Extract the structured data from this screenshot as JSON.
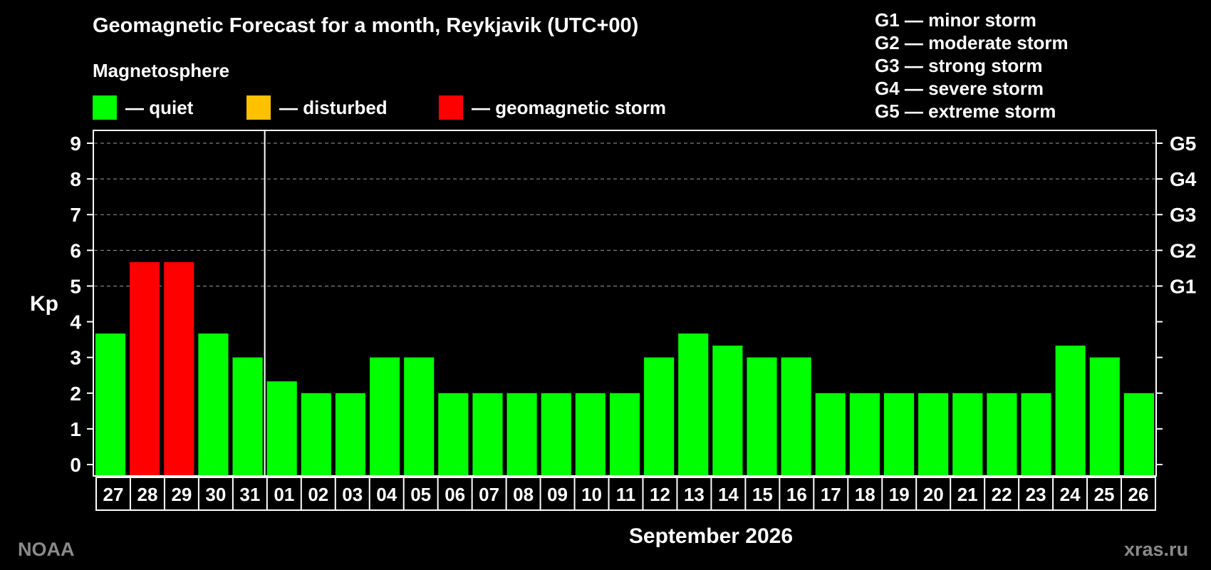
{
  "title": "Geomagnetic Forecast for a month, Reykjavik (UTC+00)",
  "legend": {
    "heading": "Magnetosphere",
    "items": [
      {
        "label": "— quiet",
        "color": "#00ff00"
      },
      {
        "label": "— disturbed",
        "color": "#ffc000"
      },
      {
        "label": "— geomagnetic storm",
        "color": "#ff0000"
      }
    ]
  },
  "storm_scale": [
    "G1 — minor storm",
    "G2 — moderate storm",
    "G3 — strong storm",
    "G4 — severe storm",
    "G5 — extreme storm"
  ],
  "credits": {
    "left": "NOAA",
    "right": "xras.ru"
  },
  "chart_data": {
    "type": "bar",
    "ylabel": "Kp",
    "xlabel": "September 2026",
    "ylim": [
      0,
      9
    ],
    "yticks": [
      0,
      1,
      2,
      3,
      4,
      5,
      6,
      7,
      8,
      9
    ],
    "grid": "dashed horizontal at Kp 5-9",
    "right_axis_labels": [
      {
        "kp": 5,
        "label": "G1"
      },
      {
        "kp": 6,
        "label": "G2"
      },
      {
        "kp": 7,
        "label": "G3"
      },
      {
        "kp": 8,
        "label": "G4"
      },
      {
        "kp": 9,
        "label": "G5"
      }
    ],
    "month_divider_after": "31",
    "categories": [
      "27",
      "28",
      "29",
      "30",
      "31",
      "01",
      "02",
      "03",
      "04",
      "05",
      "06",
      "07",
      "08",
      "09",
      "10",
      "11",
      "12",
      "13",
      "14",
      "15",
      "16",
      "17",
      "18",
      "19",
      "20",
      "21",
      "22",
      "23",
      "24",
      "25",
      "26"
    ],
    "values": [
      3.67,
      5.67,
      5.67,
      3.67,
      3,
      2.33,
      2,
      2,
      3,
      3,
      2,
      2,
      2,
      2,
      2,
      2,
      3,
      3.67,
      3.33,
      3,
      3,
      2,
      2,
      2,
      2,
      2,
      2,
      2,
      3.33,
      3,
      2
    ],
    "colors": [
      "#00ff00",
      "#ff0000",
      "#ff0000",
      "#00ff00",
      "#00ff00",
      "#00ff00",
      "#00ff00",
      "#00ff00",
      "#00ff00",
      "#00ff00",
      "#00ff00",
      "#00ff00",
      "#00ff00",
      "#00ff00",
      "#00ff00",
      "#00ff00",
      "#00ff00",
      "#00ff00",
      "#00ff00",
      "#00ff00",
      "#00ff00",
      "#00ff00",
      "#00ff00",
      "#00ff00",
      "#00ff00",
      "#00ff00",
      "#00ff00",
      "#00ff00",
      "#00ff00",
      "#00ff00",
      "#00ff00"
    ]
  }
}
